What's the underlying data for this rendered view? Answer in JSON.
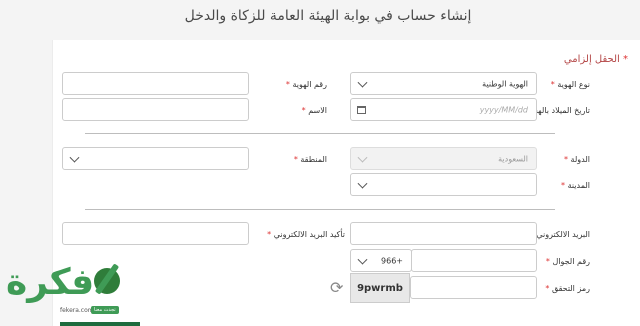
{
  "page": {
    "title": "إنشاء حساب في بوابة الهيئة العامة للزكاة والدخل",
    "required_note": "الحقل إلزامي"
  },
  "form": {
    "id_type": {
      "label": "نوع الهوية",
      "value": "الهوية الوطنية"
    },
    "id_number": {
      "label": "رقم الهوية",
      "value": ""
    },
    "hijri_dob": {
      "label": "تاريخ الميلاد بالهجري",
      "placeholder": "yyyy/MM/dd"
    },
    "name": {
      "label": "الاسم",
      "value": ""
    },
    "country": {
      "label": "الدولة",
      "value": "السعودية"
    },
    "region": {
      "label": "المنطقة",
      "value": ""
    },
    "city": {
      "label": "المدينة",
      "value": ""
    },
    "email": {
      "label": "البريد الالكتروني",
      "value": ""
    },
    "email_confirm": {
      "label": "تأكيد البريد الالكتروني",
      "value": ""
    },
    "mobile": {
      "label": "رقم الجوال",
      "country_code": "+966",
      "value": ""
    },
    "captcha": {
      "label": "رمز التحقق",
      "code": "9pwrmb",
      "value": ""
    }
  },
  "watermark": {
    "brand": "فكرة",
    "url": "fekera.com",
    "badge": "تجدث معنا",
    "brand_color": "#3f9b56"
  },
  "icons": {
    "calendar": "calendar-icon",
    "refresh": "refresh-icon",
    "chevron": "chevron-down-icon"
  }
}
